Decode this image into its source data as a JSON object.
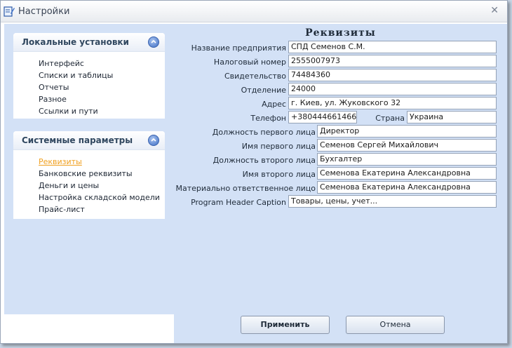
{
  "window": {
    "title": "Настройки"
  },
  "sidebar": {
    "groups": [
      {
        "title": "Локальные установки",
        "items": [
          "Интерфейс",
          "Списки и таблицы",
          "Отчеты",
          "Разное",
          "Ссылки и пути"
        ]
      },
      {
        "title": "Системные параметры",
        "items": [
          "Реквизиты",
          "Банковские реквизиты",
          "Деньги и цены",
          "Настройка складской модели",
          "Прайс-лист"
        ],
        "active_item": "Реквизиты"
      }
    ]
  },
  "main": {
    "heading": "Реквизиты",
    "fields": {
      "company_name": {
        "label": "Название предприятия",
        "value": "СПД Семенов С.М."
      },
      "tax_number": {
        "label": "Налоговый номер",
        "value": "2555007973"
      },
      "certificate": {
        "label": "Свидетельство",
        "value": "74484360"
      },
      "branch": {
        "label": "Отделение",
        "value": "24000"
      },
      "address": {
        "label": "Адрес",
        "value": "г. Киев, ул. Жуковского 32"
      },
      "phone": {
        "label": "Телефон",
        "value": "+380444661466"
      },
      "country": {
        "label": "Страна",
        "value": "Украина"
      },
      "first_person_position": {
        "label": "Должность первого лица",
        "value": "Директор"
      },
      "first_person_name": {
        "label": "Имя первого лица",
        "value": "Семенов Сергей Михайлович"
      },
      "second_person_position": {
        "label": "Должность второго лица",
        "value": "Бухгалтер"
      },
      "second_person_name": {
        "label": "Имя второго лица",
        "value": "Семенова Екатерина Александровна"
      },
      "responsible_person": {
        "label": "Материально ответственное лицо",
        "value": "Семенова Екатерина Александровна"
      },
      "header_caption": {
        "label": "Program Header Caption",
        "value": "Товары, цены, учет..."
      }
    }
  },
  "buttons": {
    "apply": "Применить",
    "cancel": "Отмена"
  }
}
